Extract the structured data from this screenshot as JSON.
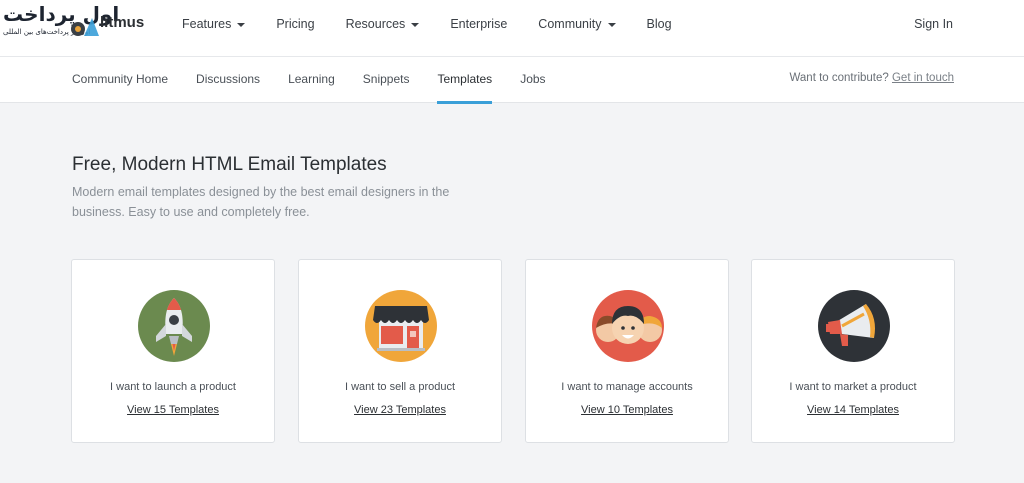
{
  "brand": {
    "logo_text": "اول پرداخت",
    "logo_subtext": "اول در پرداخت‌های بین المللی",
    "wordmark": "litmus"
  },
  "nav": {
    "items": [
      {
        "label": "Features",
        "dropdown": true
      },
      {
        "label": "Pricing",
        "dropdown": false
      },
      {
        "label": "Resources",
        "dropdown": true
      },
      {
        "label": "Enterprise",
        "dropdown": false
      },
      {
        "label": "Community",
        "dropdown": true
      },
      {
        "label": "Blog",
        "dropdown": false
      }
    ],
    "signin": "Sign In"
  },
  "subnav": {
    "items": [
      {
        "label": "Community Home"
      },
      {
        "label": "Discussions"
      },
      {
        "label": "Learning"
      },
      {
        "label": "Snippets"
      },
      {
        "label": "Templates",
        "active": true
      },
      {
        "label": "Jobs"
      }
    ],
    "contribute_text": "Want to contribute?",
    "contribute_link": "Get in touch"
  },
  "hero": {
    "title": "Free, Modern HTML Email Templates",
    "description": "Modern email templates designed by the best email designers in the business. Easy to use and completely free."
  },
  "cards": [
    {
      "label": "I want to launch a product",
      "link": "View 15 Templates",
      "icon": "rocket-icon",
      "color": "#6b8a4f"
    },
    {
      "label": "I want to sell a product",
      "link": "View 23 Templates",
      "icon": "storefront-icon",
      "color": "#f0a63a"
    },
    {
      "label": "I want to manage accounts",
      "link": "View 10 Templates",
      "icon": "people-icon",
      "color": "#e35b4a"
    },
    {
      "label": "I want to market a product",
      "link": "View 14 Templates",
      "icon": "megaphone-icon",
      "color": "#2e3237"
    }
  ],
  "colors": {
    "accent": "#3a9fd8",
    "background": "#f3f4f6"
  }
}
